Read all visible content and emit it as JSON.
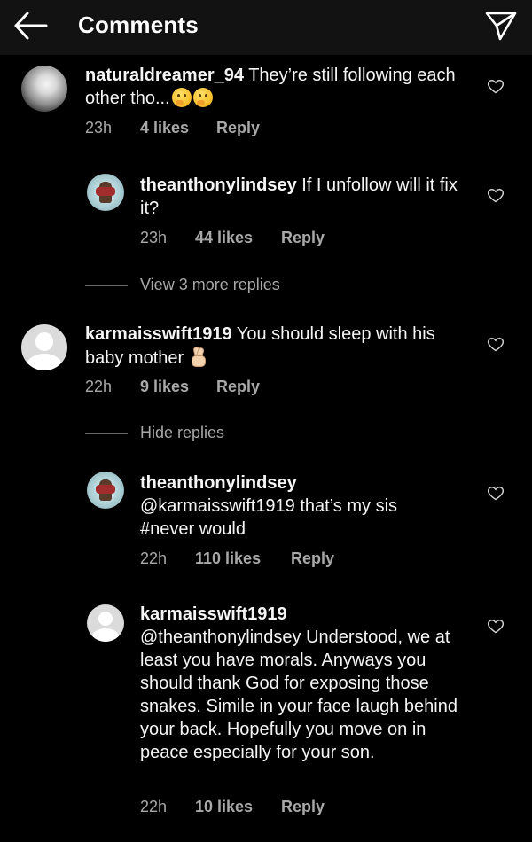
{
  "header": {
    "title": "Comments"
  },
  "comments": [
    {
      "username": "naturaldreamer_94",
      "text": "They’re still following each other tho...",
      "time": "23h",
      "likes": "4 likes",
      "reply_label": "Reply",
      "emoji": "thinking-face"
    },
    {
      "username": "theanthonylindsey",
      "text": "If I unfollow will it fix it?",
      "time": "23h",
      "likes": "44 likes",
      "reply_label": "Reply"
    },
    {
      "username": "karmaisswift1919",
      "text": "You should sleep with his baby mother",
      "time": "22h",
      "likes": "9 likes",
      "reply_label": "Reply",
      "emoji": "crossed-fingers"
    },
    {
      "username": "theanthonylindsey",
      "text": "@karmaisswift1919 that’s my sis #never would",
      "time": "22h",
      "likes": "110 likes",
      "reply_label": "Reply"
    },
    {
      "username": "karmaisswift1919",
      "text": "@theanthonylindsey Understood, we at least you have morals. Anyways you should thank God for exposing those snakes. Simile in your face laugh behind your back. Hopefully you move on in peace especially for your son.",
      "time": "22h",
      "likes": "10 likes",
      "reply_label": "Reply"
    }
  ],
  "view_more_replies": "View 3 more replies",
  "hide_replies": "Hide replies",
  "icons": {
    "back": "back-arrow-icon",
    "send": "send-icon",
    "like": "heart-icon"
  },
  "colors": {
    "background": "#000000",
    "header": "#121212",
    "text": "#f5f5f5",
    "secondary": "#a8a8a8"
  }
}
